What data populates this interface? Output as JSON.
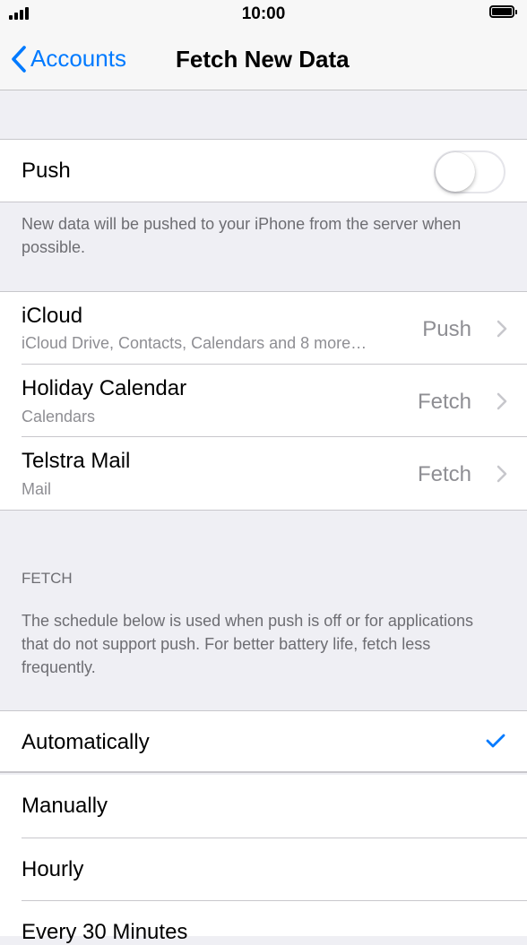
{
  "status_bar": {
    "time": "10:00"
  },
  "nav": {
    "back_label": "Accounts",
    "title": "Fetch New Data"
  },
  "push": {
    "label": "Push",
    "enabled": false,
    "footer": "New data will be pushed to your iPhone from the server when possible."
  },
  "accounts": [
    {
      "name": "iCloud",
      "detail": "iCloud Drive, Contacts, Calendars and 8 more…",
      "value": "Push"
    },
    {
      "name": "Holiday Calendar",
      "detail": "Calendars",
      "value": "Fetch"
    },
    {
      "name": "Telstra Mail",
      "detail": "Mail",
      "value": "Fetch"
    }
  ],
  "fetch": {
    "header": "FETCH",
    "description": "The schedule below is used when push is off or for applications that do not support push. For better battery life, fetch less frequently.",
    "options": [
      {
        "label": "Automatically",
        "selected": true
      },
      {
        "label": "Manually",
        "selected": false
      },
      {
        "label": "Hourly",
        "selected": false
      },
      {
        "label": "Every 30 Minutes",
        "selected": false
      }
    ]
  },
  "colors": {
    "accent": "#007aff",
    "background": "#efeff4",
    "secondary_text": "#8e8e93"
  }
}
